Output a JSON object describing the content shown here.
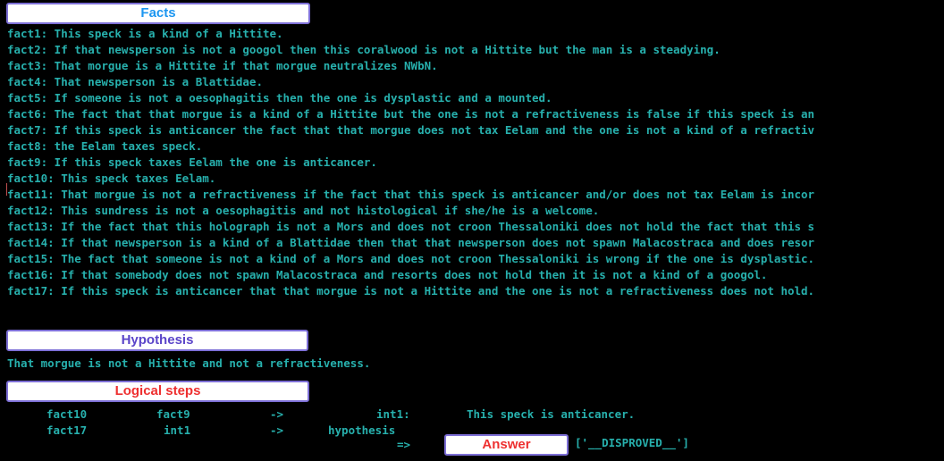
{
  "labels": {
    "facts": "Facts",
    "hypothesis": "Hypothesis",
    "logical_steps": "Logical steps",
    "answer": "Answer"
  },
  "facts": [
    "fact1: This speck is a kind of a Hittite.",
    "fact2: If that newsperson is not a googol then this coralwood is not a Hittite but the man is a steadying.",
    "fact3: That morgue is a Hittite if that morgue neutralizes NWbN.",
    "fact4: That newsperson is a Blattidae.",
    "fact5: If someone is not a oesophagitis then the one is dysplastic and a mounted.",
    "fact6: The fact that that morgue is a kind of a Hittite but the one is not a refractiveness is false if this speck is an",
    "fact7: If this speck is anticancer the fact that that morgue does not tax Eelam and the one is not a kind of a refractiv",
    "fact8: the Eelam taxes speck.",
    "fact9: If this speck taxes Eelam the one is anticancer.",
    "fact10: This speck taxes Eelam.",
    "fact11: That morgue is not a refractiveness if the fact that this speck is anticancer and/or does not tax Eelam is incor",
    "fact12: This sundress is not a oesophagitis and not histological if she/he is a welcome.",
    "fact13: If the fact that this holograph is not a Mors and does not croon Thessaloniki does not hold the fact that this s",
    "fact14: If that newsperson is a kind of a Blattidae then that that newsperson does not spawn Malacostraca and does resor",
    "fact15: The fact that someone is not a kind of a Mors and does not croon Thessaloniki is wrong if the one is dysplastic.",
    "fact16: If that somebody does not spawn Malacostraca and resorts does not hold then it is not a kind of a googol.",
    "fact17: If this speck is anticancer that that morgue is not a Hittite and the one is not a refractiveness does not hold."
  ],
  "hypothesis": "That morgue is not a Hittite and not a refractiveness.",
  "steps": [
    {
      "premise1": "fact10",
      "premise2": "fact9",
      "arrow": "->",
      "conclusion": "int1:",
      "text": "This speck is anticancer."
    },
    {
      "premise1": "fact17",
      "premise2": "int1",
      "arrow": "->",
      "conclusion": "hypothesis",
      "text": ""
    }
  ],
  "final_arrow": "=>",
  "answer": "['__DISPROVED__']",
  "colors": {
    "background": "#000000",
    "text": "#27b0ad",
    "label_border": "#7d6fd6",
    "facts_label": "#1c96f0",
    "hypothesis_label": "#5b45c9",
    "steps_label": "#ee3030",
    "answer_label": "#ee3030"
  }
}
